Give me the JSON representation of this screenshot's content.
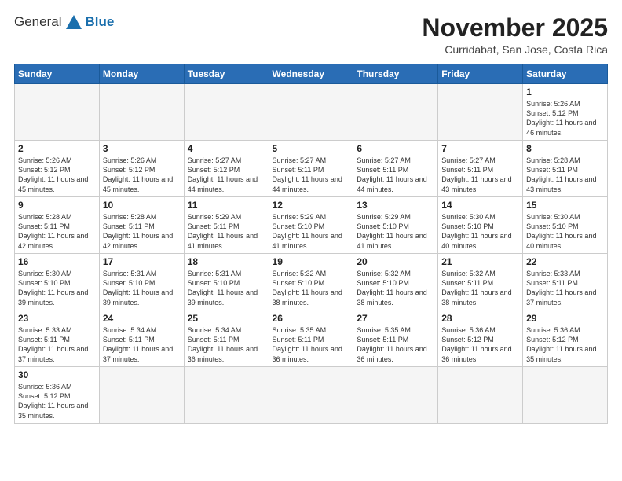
{
  "header": {
    "logo_general": "General",
    "logo_blue": "Blue",
    "month_title": "November 2025",
    "location": "Curridabat, San Jose, Costa Rica"
  },
  "weekdays": [
    "Sunday",
    "Monday",
    "Tuesday",
    "Wednesday",
    "Thursday",
    "Friday",
    "Saturday"
  ],
  "weeks": [
    [
      {
        "day": "",
        "empty": true
      },
      {
        "day": "",
        "empty": true
      },
      {
        "day": "",
        "empty": true
      },
      {
        "day": "",
        "empty": true
      },
      {
        "day": "",
        "empty": true
      },
      {
        "day": "",
        "empty": true
      },
      {
        "day": "1",
        "sunrise": "5:26 AM",
        "sunset": "5:12 PM",
        "daylight": "11 hours and 46 minutes."
      }
    ],
    [
      {
        "day": "2",
        "sunrise": "5:26 AM",
        "sunset": "5:12 PM",
        "daylight": "11 hours and 45 minutes."
      },
      {
        "day": "3",
        "sunrise": "5:26 AM",
        "sunset": "5:12 PM",
        "daylight": "11 hours and 45 minutes."
      },
      {
        "day": "4",
        "sunrise": "5:27 AM",
        "sunset": "5:12 PM",
        "daylight": "11 hours and 44 minutes."
      },
      {
        "day": "5",
        "sunrise": "5:27 AM",
        "sunset": "5:11 PM",
        "daylight": "11 hours and 44 minutes."
      },
      {
        "day": "6",
        "sunrise": "5:27 AM",
        "sunset": "5:11 PM",
        "daylight": "11 hours and 44 minutes."
      },
      {
        "day": "7",
        "sunrise": "5:27 AM",
        "sunset": "5:11 PM",
        "daylight": "11 hours and 43 minutes."
      },
      {
        "day": "8",
        "sunrise": "5:28 AM",
        "sunset": "5:11 PM",
        "daylight": "11 hours and 43 minutes."
      }
    ],
    [
      {
        "day": "9",
        "sunrise": "5:28 AM",
        "sunset": "5:11 PM",
        "daylight": "11 hours and 42 minutes."
      },
      {
        "day": "10",
        "sunrise": "5:28 AM",
        "sunset": "5:11 PM",
        "daylight": "11 hours and 42 minutes."
      },
      {
        "day": "11",
        "sunrise": "5:29 AM",
        "sunset": "5:11 PM",
        "daylight": "11 hours and 41 minutes."
      },
      {
        "day": "12",
        "sunrise": "5:29 AM",
        "sunset": "5:10 PM",
        "daylight": "11 hours and 41 minutes."
      },
      {
        "day": "13",
        "sunrise": "5:29 AM",
        "sunset": "5:10 PM",
        "daylight": "11 hours and 41 minutes."
      },
      {
        "day": "14",
        "sunrise": "5:30 AM",
        "sunset": "5:10 PM",
        "daylight": "11 hours and 40 minutes."
      },
      {
        "day": "15",
        "sunrise": "5:30 AM",
        "sunset": "5:10 PM",
        "daylight": "11 hours and 40 minutes."
      }
    ],
    [
      {
        "day": "16",
        "sunrise": "5:30 AM",
        "sunset": "5:10 PM",
        "daylight": "11 hours and 39 minutes."
      },
      {
        "day": "17",
        "sunrise": "5:31 AM",
        "sunset": "5:10 PM",
        "daylight": "11 hours and 39 minutes."
      },
      {
        "day": "18",
        "sunrise": "5:31 AM",
        "sunset": "5:10 PM",
        "daylight": "11 hours and 39 minutes."
      },
      {
        "day": "19",
        "sunrise": "5:32 AM",
        "sunset": "5:10 PM",
        "daylight": "11 hours and 38 minutes."
      },
      {
        "day": "20",
        "sunrise": "5:32 AM",
        "sunset": "5:10 PM",
        "daylight": "11 hours and 38 minutes."
      },
      {
        "day": "21",
        "sunrise": "5:32 AM",
        "sunset": "5:11 PM",
        "daylight": "11 hours and 38 minutes."
      },
      {
        "day": "22",
        "sunrise": "5:33 AM",
        "sunset": "5:11 PM",
        "daylight": "11 hours and 37 minutes."
      }
    ],
    [
      {
        "day": "23",
        "sunrise": "5:33 AM",
        "sunset": "5:11 PM",
        "daylight": "11 hours and 37 minutes."
      },
      {
        "day": "24",
        "sunrise": "5:34 AM",
        "sunset": "5:11 PM",
        "daylight": "11 hours and 37 minutes."
      },
      {
        "day": "25",
        "sunrise": "5:34 AM",
        "sunset": "5:11 PM",
        "daylight": "11 hours and 36 minutes."
      },
      {
        "day": "26",
        "sunrise": "5:35 AM",
        "sunset": "5:11 PM",
        "daylight": "11 hours and 36 minutes."
      },
      {
        "day": "27",
        "sunrise": "5:35 AM",
        "sunset": "5:11 PM",
        "daylight": "11 hours and 36 minutes."
      },
      {
        "day": "28",
        "sunrise": "5:36 AM",
        "sunset": "5:12 PM",
        "daylight": "11 hours and 36 minutes."
      },
      {
        "day": "29",
        "sunrise": "5:36 AM",
        "sunset": "5:12 PM",
        "daylight": "11 hours and 35 minutes."
      }
    ],
    [
      {
        "day": "30",
        "sunrise": "5:36 AM",
        "sunset": "5:12 PM",
        "daylight": "11 hours and 35 minutes."
      },
      {
        "day": "",
        "empty": true
      },
      {
        "day": "",
        "empty": true
      },
      {
        "day": "",
        "empty": true
      },
      {
        "day": "",
        "empty": true
      },
      {
        "day": "",
        "empty": true
      },
      {
        "day": "",
        "empty": true
      }
    ]
  ]
}
